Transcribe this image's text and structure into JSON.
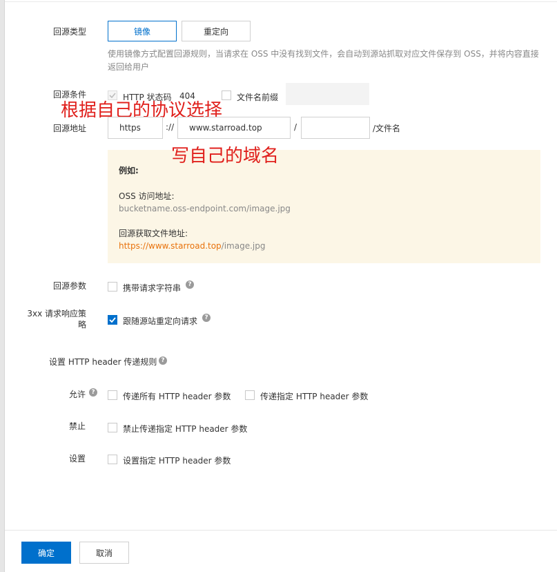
{
  "source_type": {
    "label": "回源类型",
    "options": [
      "镜像",
      "重定向"
    ],
    "selected": "镜像",
    "hint": "使用镜像方式配置回源规则，当请求在 OSS 中没有找到文件，会自动到源站抓取对应文件保存到 OSS，并将内容直接返回给用户"
  },
  "condition": {
    "label": "回源条件",
    "http_status_label": "HTTP 状态码",
    "http_status_value": "404",
    "prefix_label": "文件名前缀",
    "prefix_value": ""
  },
  "origin": {
    "label": "回源地址",
    "protocol": "https",
    "sep1": "://",
    "domain": "www.starroad.top",
    "sep2": "/",
    "path": "",
    "suffix": "/文件名"
  },
  "example": {
    "title": "例如:",
    "oss_label": "OSS 访问地址:",
    "oss_url": "bucketname.oss-endpoint.com/image.jpg",
    "origin_label": "回源获取文件地址:",
    "origin_url_protocol": "https://",
    "origin_url_domain": "www.starroad.top",
    "origin_url_path": "/image.jpg"
  },
  "params": {
    "label": "回源参数",
    "carry_query_label": "携带请求字符串",
    "carry_query_checked": false
  },
  "redirect_3xx": {
    "label_line1": "3xx 请求响应策",
    "label_line2": "略",
    "follow_label": "跟随源站重定向请求",
    "follow_checked": true
  },
  "header_rules": {
    "title": "设置 HTTP header 传递规则",
    "allow_label": "允许",
    "allow_all_label": "传递所有 HTTP header 参数",
    "allow_specific_label": "传递指定 HTTP header 参数",
    "forbid_label": "禁止",
    "forbid_specific_label": "禁止传递指定 HTTP header 参数",
    "set_label": "设置",
    "set_specific_label": "设置指定 HTTP header 参数"
  },
  "annotations": {
    "protocol_note": "根据自己的协议选择",
    "domain_note": "写自己的域名",
    "color": "#e0201c"
  },
  "footer": {
    "confirm": "确定",
    "cancel": "取消"
  },
  "colors": {
    "primary": "#0070cc",
    "example_bg": "#fcf6e6",
    "link_orange": "#e8720c"
  }
}
